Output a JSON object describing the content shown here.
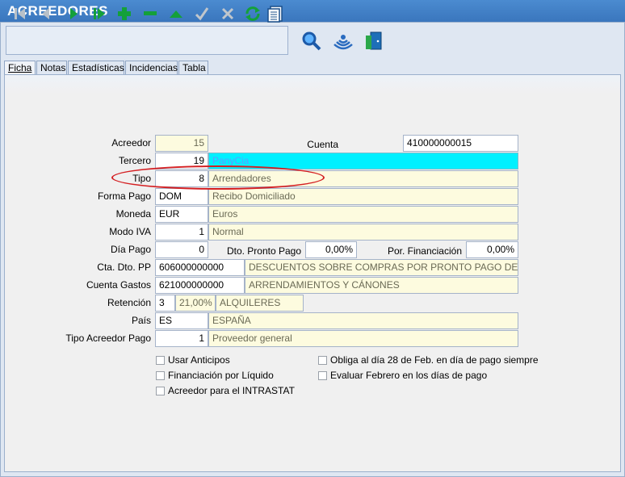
{
  "window": {
    "title": "ACREEDORES"
  },
  "toolbar": {
    "buttons": [
      "first-icon",
      "prev-icon",
      "next-icon",
      "last-icon",
      "add-icon",
      "delete-icon",
      "up-icon",
      "confirm-icon",
      "cancel-icon",
      "refresh-icon",
      "list-icon"
    ],
    "extra": [
      "search-icon",
      "wifi-icon",
      "exit-door-icon"
    ]
  },
  "tabs": [
    "Ficha",
    "Notas",
    "Estadísticas",
    "Incidencias",
    "Tabla"
  ],
  "form": {
    "acreedor": {
      "label": "Acreedor",
      "value": "15"
    },
    "cuenta": {
      "label": "Cuenta",
      "value": "410000000015"
    },
    "tercero": {
      "label": "Tercero",
      "value": "19",
      "desc": "PanyCia"
    },
    "tipo": {
      "label": "Tipo",
      "value": "8",
      "desc": "Arrendadores"
    },
    "forma_pago": {
      "label": "Forma Pago",
      "value": "DOM",
      "desc": "Recibo Domiciliado"
    },
    "moneda": {
      "label": "Moneda",
      "value": "EUR",
      "desc": "Euros"
    },
    "modo_iva": {
      "label": "Modo IVA",
      "value": "1",
      "desc": "Normal"
    },
    "dia_pago": {
      "label": "Día Pago",
      "value": "0"
    },
    "dto_pronto_pago": {
      "label": "Dto. Pronto Pago",
      "value": "0,00%"
    },
    "por_financiacion": {
      "label": "Por. Financiación",
      "value": "0,00%"
    },
    "cta_dto_pp": {
      "label": "Cta. Dto. PP",
      "value": "606000000000",
      "desc": "DESCUENTOS SOBRE COMPRAS POR PRONTO PAGO DE MERC"
    },
    "cuenta_gastos": {
      "label": "Cuenta Gastos",
      "value": "621000000000",
      "desc": "ARRENDAMIENTOS Y CÁNONES"
    },
    "retencion": {
      "label": "Retención",
      "value": "3",
      "percent": "21,00%",
      "desc": "ALQUILERES"
    },
    "pais": {
      "label": "País",
      "value": "ES",
      "desc": "ESPAÑA"
    },
    "tipo_acreedor_pago": {
      "label": "Tipo Acreedor Pago",
      "value": "1",
      "desc": "Proveedor general"
    }
  },
  "checkboxes": {
    "usar_anticipos": {
      "label": "Usar Anticipos",
      "checked": false
    },
    "financiacion_liquido": {
      "label": "Financiación por Líquido",
      "checked": false
    },
    "intrastat": {
      "label": "Acreedor para el INTRASTAT",
      "checked": false
    },
    "obliga_28": {
      "label": "Obliga al día 28 de Feb. en día de pago siempre",
      "checked": false
    },
    "evaluar_febrero": {
      "label": "Evaluar Febrero en los días de pago",
      "checked": false
    }
  },
  "colors": {
    "titlebar": "#3a76bd",
    "highlight_field": "#00f0ff",
    "readonly_field": "#fdfbdf",
    "annotation": "#d41f22"
  }
}
